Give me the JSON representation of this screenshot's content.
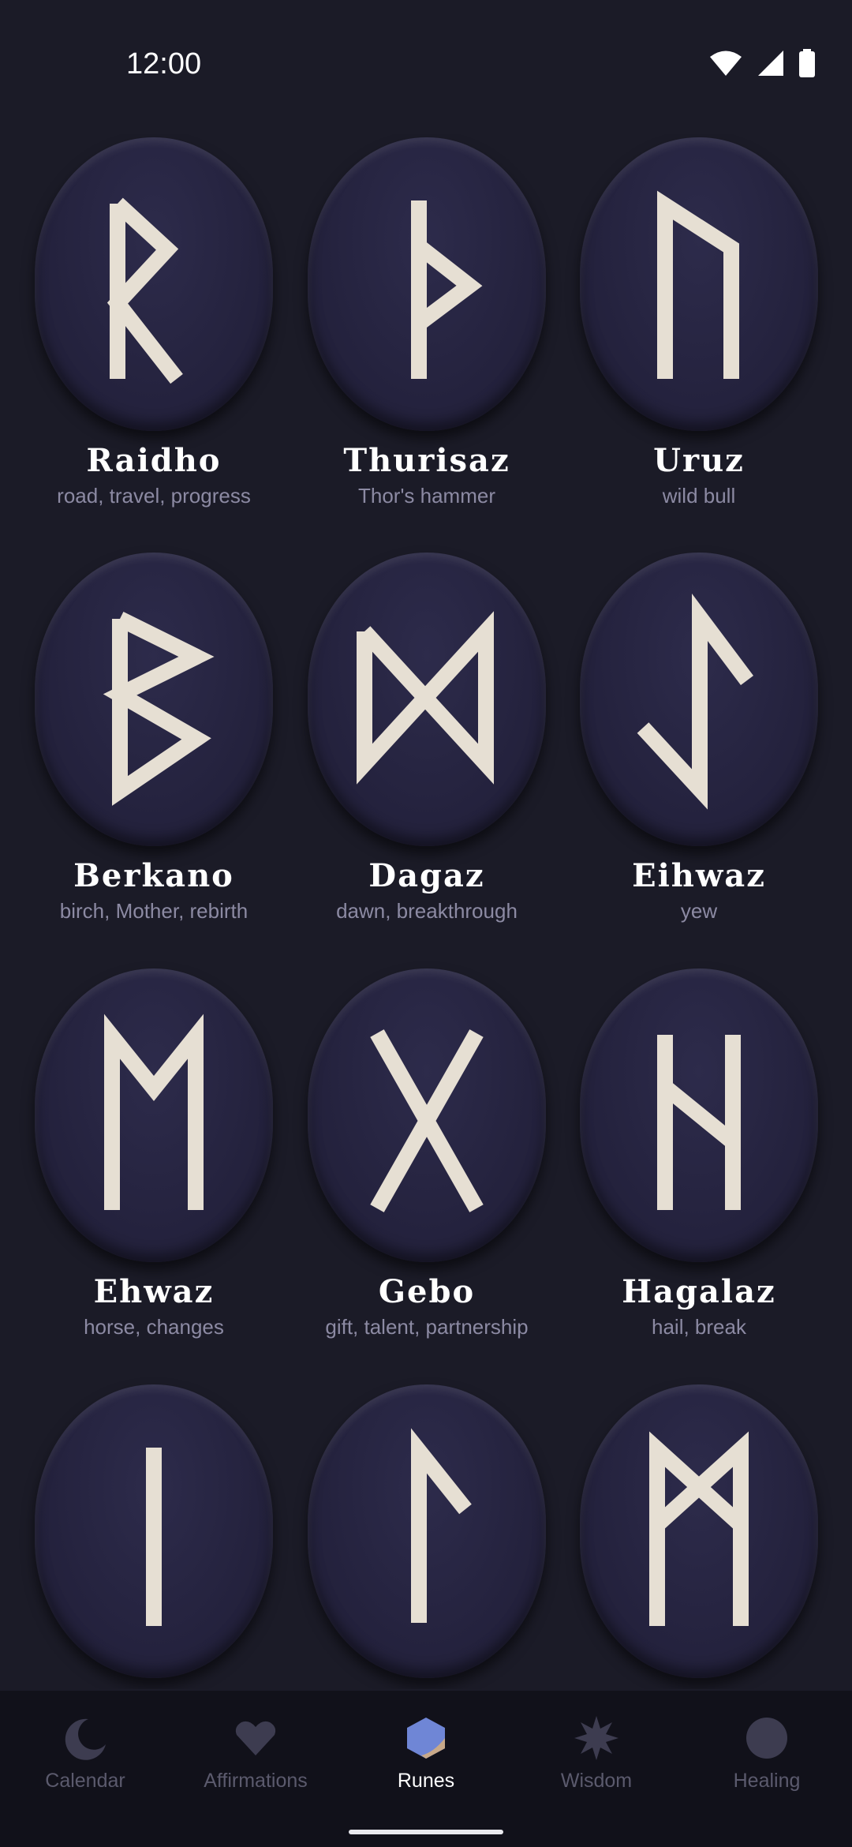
{
  "status_bar": {
    "time": "12:00"
  },
  "runes": [
    {
      "name": "Raidho",
      "meaning": "road, travel, progress",
      "icon": "raidho-rune-icon"
    },
    {
      "name": "Thurisaz",
      "meaning": "Thor's hammer",
      "icon": "thurisaz-rune-icon"
    },
    {
      "name": "Uruz",
      "meaning": "wild bull",
      "icon": "uruz-rune-icon"
    },
    {
      "name": "Berkano",
      "meaning": "birch, Mother, rebirth",
      "icon": "berkano-rune-icon"
    },
    {
      "name": "Dagaz",
      "meaning": "dawn, breakthrough",
      "icon": "dagaz-rune-icon"
    },
    {
      "name": "Eihwaz",
      "meaning": "yew",
      "icon": "eihwaz-rune-icon"
    },
    {
      "name": "Ehwaz",
      "meaning": "horse, changes",
      "icon": "ehwaz-rune-icon"
    },
    {
      "name": "Gebo",
      "meaning": "gift, talent, partnership",
      "icon": "gebo-rune-icon"
    },
    {
      "name": "Hagalaz",
      "meaning": "hail, break",
      "icon": "hagalaz-rune-icon"
    },
    {
      "icon": "isa-rune-icon"
    },
    {
      "icon": "laguz-rune-icon"
    },
    {
      "icon": "mannaz-rune-icon"
    }
  ],
  "bottom_nav": {
    "items": [
      {
        "label": "Calendar",
        "icon": "moon-icon"
      },
      {
        "label": "Affirmations",
        "icon": "heart-icon"
      },
      {
        "label": "Runes",
        "icon": "hexagon-icon",
        "active": true
      },
      {
        "label": "Wisdom",
        "icon": "star-burst-icon"
      },
      {
        "label": "Healing",
        "icon": "circle-icon"
      }
    ]
  },
  "colors": {
    "background": "#1b1b27",
    "stone": "#25233f",
    "rune_glyph": "#e6dfd3",
    "nav_background": "#11111a",
    "nav_inactive": "#5b5a6d",
    "accent": "#6f86d6"
  }
}
